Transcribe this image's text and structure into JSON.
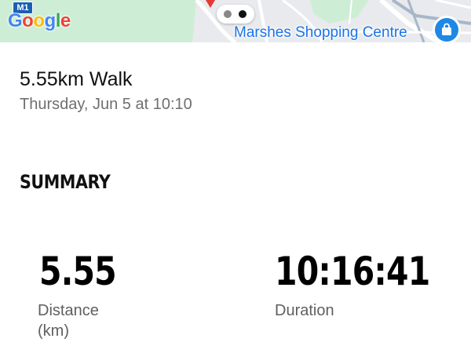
{
  "map": {
    "road_shield": "M1",
    "logo": [
      "G",
      "o",
      "o",
      "g",
      "l",
      "e"
    ],
    "place_label": "Marshes Shopping Centre",
    "pin_icon": "shopping-bag-icon",
    "pager": {
      "pages": 2,
      "current": 2
    },
    "colors": {
      "place_label": "#1a73e8",
      "pin": "#1e88e5",
      "road": "#1a5fb4"
    }
  },
  "activity": {
    "title": "5.55km Walk",
    "subtitle": "Thursday, Jun 5 at 10:10"
  },
  "summary": {
    "heading": "SUMMARY",
    "stats": [
      {
        "value": "5.55",
        "label": "Distance (km)"
      },
      {
        "value": "10:16:41",
        "label": "Duration"
      }
    ]
  }
}
